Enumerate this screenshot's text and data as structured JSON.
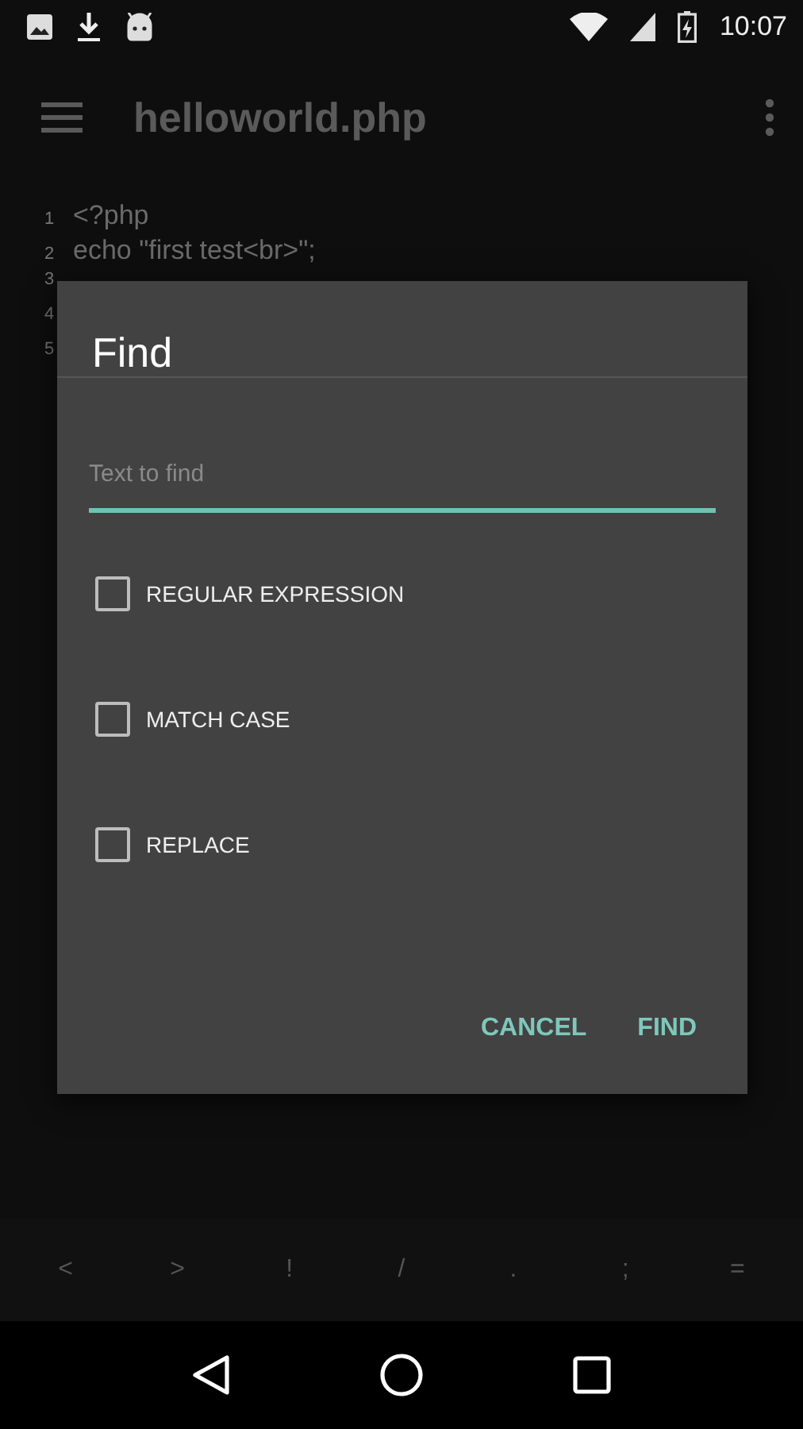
{
  "status_bar": {
    "time": "10:07"
  },
  "app_bar": {
    "title": "helloworld.php"
  },
  "editor": {
    "lines": [
      {
        "number": "1",
        "text": "<?php"
      },
      {
        "number": "2",
        "text": "echo \"first test<br>\";"
      },
      {
        "number": "3"
      },
      {
        "number": "4"
      },
      {
        "number": "5"
      }
    ]
  },
  "dialog": {
    "title": "Find",
    "search": {
      "placeholder": "Text to find"
    },
    "options": [
      {
        "label": "REGULAR EXPRESSION",
        "checked": false
      },
      {
        "label": "MATCH CASE",
        "checked": false
      },
      {
        "label": "REPLACE",
        "checked": false
      }
    ],
    "buttons": [
      "CANCEL",
      "FIND"
    ]
  },
  "symbol_keys": [
    "<",
    ">",
    "!",
    "/",
    ".",
    ";",
    "="
  ]
}
